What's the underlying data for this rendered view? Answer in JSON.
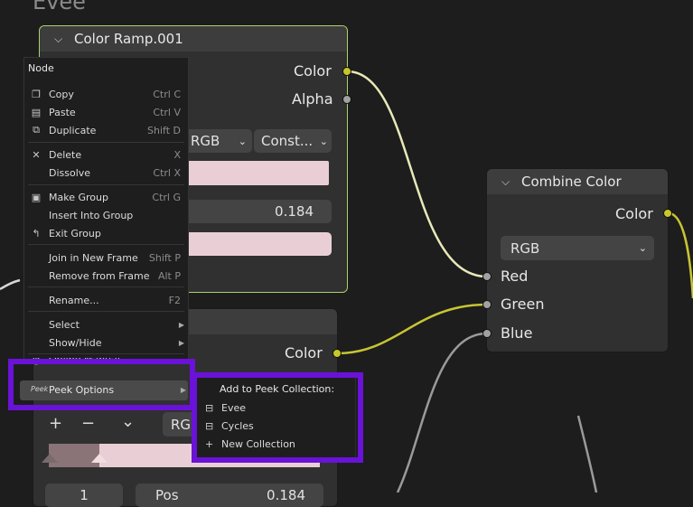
{
  "background_title": "Evee",
  "color_ramp_node": {
    "title": "Color Ramp.001",
    "outputs": [
      "Color",
      "Alpha"
    ],
    "mode_select": "RGB",
    "interp_select": "Const...",
    "value": "0.184"
  },
  "combine_node": {
    "title": "Combine Color",
    "output": "Color",
    "mode_select": "RGB",
    "inputs": [
      "Red",
      "Green",
      "Blue"
    ]
  },
  "lower_node": {
    "output": "Color",
    "mode_select": "RGB",
    "buttons": [
      "+",
      "−",
      "⌄"
    ],
    "stop_index": "1",
    "pos_label": "Pos",
    "pos_value": "0.184"
  },
  "context_menu": {
    "title": "Node",
    "items": [
      {
        "label": "Copy",
        "shortcut": "Ctrl C"
      },
      {
        "label": "Paste",
        "shortcut": "Ctrl V"
      },
      {
        "label": "Duplicate",
        "shortcut": "Shift D"
      },
      {
        "label": "Delete",
        "shortcut": "X"
      },
      {
        "label": "Dissolve",
        "shortcut": "Ctrl X"
      },
      {
        "label": "Make Group",
        "shortcut": "Ctrl G"
      },
      {
        "label": "Insert Into Group",
        "shortcut": ""
      },
      {
        "label": "Exit Group",
        "shortcut": ""
      },
      {
        "label": "Join in New Frame",
        "shortcut": "Shift P"
      },
      {
        "label": "Remove from Frame",
        "shortcut": "Alt P"
      },
      {
        "label": "Rename...",
        "shortcut": "F2"
      },
      {
        "label": "Select",
        "shortcut": ""
      },
      {
        "label": "Show/Hide",
        "shortcut": ""
      },
      {
        "label": "Online Manual",
        "shortcut": ""
      },
      {
        "label": "Peek Options",
        "shortcut": ""
      }
    ],
    "peek_icon_text": "Peek"
  },
  "submenu": {
    "title": "Add to Peek Collection:",
    "items": [
      "Evee",
      "Cycles",
      "New Collection"
    ]
  },
  "colors": {
    "highlight": "#6a12d8",
    "socket_color": "#c7c729",
    "socket_float": "#a1a1a1",
    "selected_border": "#a7d36b"
  }
}
